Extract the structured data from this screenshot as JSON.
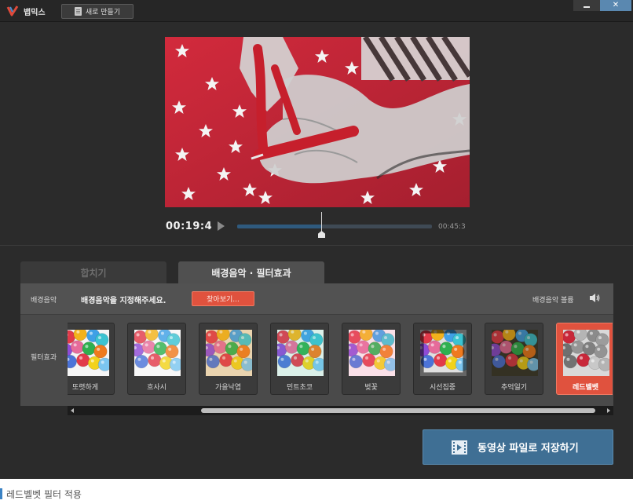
{
  "app": {
    "title": "뱁믹스",
    "new_button_label": "새로 만들기",
    "close_symbol": "✕"
  },
  "player": {
    "current_time": "00:19:4",
    "total_time": "00:45:3",
    "progress_fraction": 0.43
  },
  "tabs": [
    {
      "label": "합치기",
      "active": false
    },
    {
      "label": "배경음악 · 필터효과",
      "active": true
    }
  ],
  "music": {
    "label": "배경음악",
    "prompt": "배경음악을 지정해주세요.",
    "browse_label": "찾아보기...",
    "volume_label": "배경음악 볼륨"
  },
  "filters": {
    "label": "필터효과",
    "items": [
      {
        "name": "또렷하게",
        "tone": "normal"
      },
      {
        "name": "흐사시",
        "tone": "soft"
      },
      {
        "name": "가을낙엽",
        "tone": "warm"
      },
      {
        "name": "민트초코",
        "tone": "mint"
      },
      {
        "name": "벚꽃",
        "tone": "pink"
      },
      {
        "name": "시선집중",
        "tone": "vignette"
      },
      {
        "name": "추억일기",
        "tone": "dark"
      },
      {
        "name": "레드벨벳",
        "tone": "redgray",
        "selected": true
      }
    ]
  },
  "save_button_label": "동영상 파일로 저장하기",
  "caption": "레드벨벳 필터 적용",
  "colors": {
    "accent_red": "#e0523e",
    "save_blue": "#3f6f94",
    "caption_bar": "#3b82c4"
  }
}
